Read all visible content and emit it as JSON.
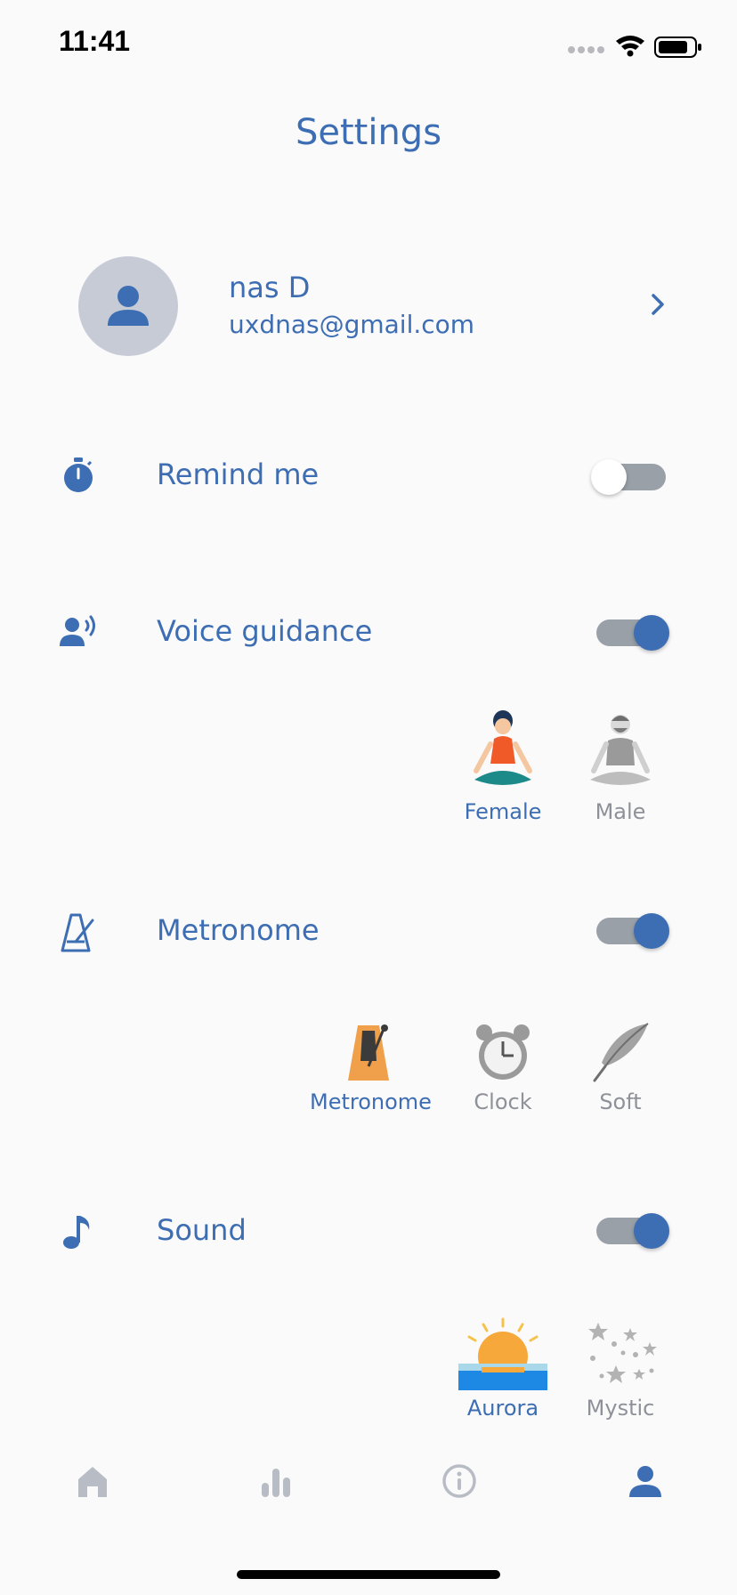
{
  "status": {
    "time": "11:41"
  },
  "header": {
    "title": "Settings"
  },
  "profile": {
    "name": "nas D",
    "email": "uxdnas@gmail.com"
  },
  "settings": {
    "remind": {
      "label": "Remind me",
      "enabled": false
    },
    "voice": {
      "label": "Voice guidance",
      "enabled": true,
      "options": [
        {
          "label": "Female",
          "selected": true
        },
        {
          "label": "Male",
          "selected": false
        }
      ]
    },
    "metronome": {
      "label": "Metronome",
      "enabled": true,
      "options": [
        {
          "label": "Metronome",
          "selected": true
        },
        {
          "label": "Clock",
          "selected": false
        },
        {
          "label": "Soft",
          "selected": false
        }
      ]
    },
    "sound": {
      "label": "Sound",
      "enabled": true,
      "options": [
        {
          "label": "Aurora",
          "selected": true
        },
        {
          "label": "Mystic",
          "selected": false
        }
      ]
    }
  },
  "tabbar": {
    "items": [
      "home-icon",
      "stats-icon",
      "info-icon",
      "profile-icon"
    ],
    "active": "profile-icon"
  },
  "colors": {
    "accent": "#3d6db2",
    "inactive": "#b8bcc4",
    "background": "#fafafb"
  }
}
